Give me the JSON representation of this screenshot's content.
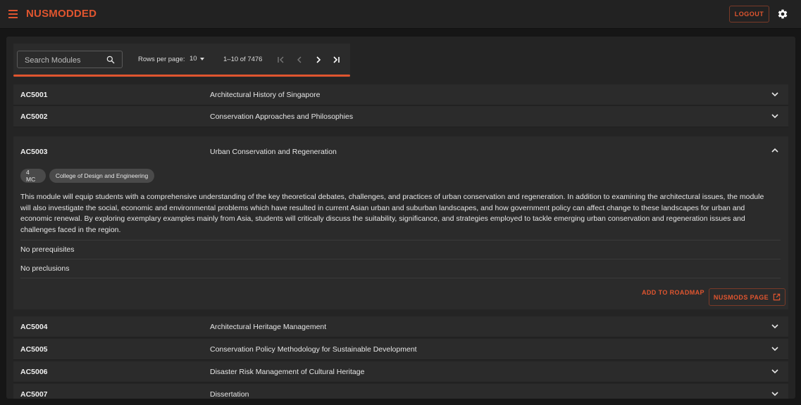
{
  "app": {
    "brand": "NUSMODDED",
    "logout_label": "LOGOUT"
  },
  "icons": {
    "menu": "hamburger-menu-icon",
    "settings": "gear-icon",
    "search": "search-icon",
    "first": "first-page-icon",
    "prev": "prev-page-icon",
    "next": "next-page-icon",
    "last": "last-page-icon",
    "expand": "chevron-down-icon",
    "collapse": "chevron-up-icon",
    "external": "external-link-icon"
  },
  "colors": {
    "accent": "#e0552f",
    "background": "#161616",
    "surface": "#2b2b2b"
  },
  "toolbar": {
    "search_placeholder": "Search Modules",
    "rows_per_page_label": "Rows per page:",
    "rows_per_page_value": "10",
    "range": "1–10 of 7476"
  },
  "modules_top": [
    {
      "code": "AC5001",
      "title": "Architectural History of Singapore"
    },
    {
      "code": "AC5002",
      "title": "Conservation Approaches and Philosophies"
    }
  ],
  "expanded_module": {
    "code": "AC5003",
    "title": "Urban Conservation and Regeneration",
    "mc": "4 MC",
    "faculty": "College of Design and Engineering",
    "description_lines": [
      "This module will equip students with a comprehensive understanding of the key theoretical debates, challenges, and practices of urban conservation and regeneration. In addition to examining the architectural issues, the module",
      "will also investigate the social, economic and environmental problems which have resulted in current Asian urban and suburban landscapes, and how government policy can affect change to these landscapes for urban and",
      "economic renewal. By exploring exemplary examples mainly from Asia, students will critically discuss the suitability, significance, and strategies employed to tackle emerging urban conservation and regeneration issues and",
      "challenges faced in the region."
    ],
    "prerequisites": "No prerequisites",
    "preclusions": "No preclusions",
    "add_to_roadmap_label": "ADD TO ROADMAP",
    "nusmods_page_label": "NUSMODS PAGE"
  },
  "modules_bottom": [
    {
      "code": "AC5004",
      "title": "Architectural Heritage Management"
    },
    {
      "code": "AC5005",
      "title": "Conservation Policy Methodology for Sustainable Development"
    },
    {
      "code": "AC5006",
      "title": "Disaster Risk Management of Cultural Heritage"
    },
    {
      "code": "AC5007",
      "title": "Dissertation"
    }
  ]
}
